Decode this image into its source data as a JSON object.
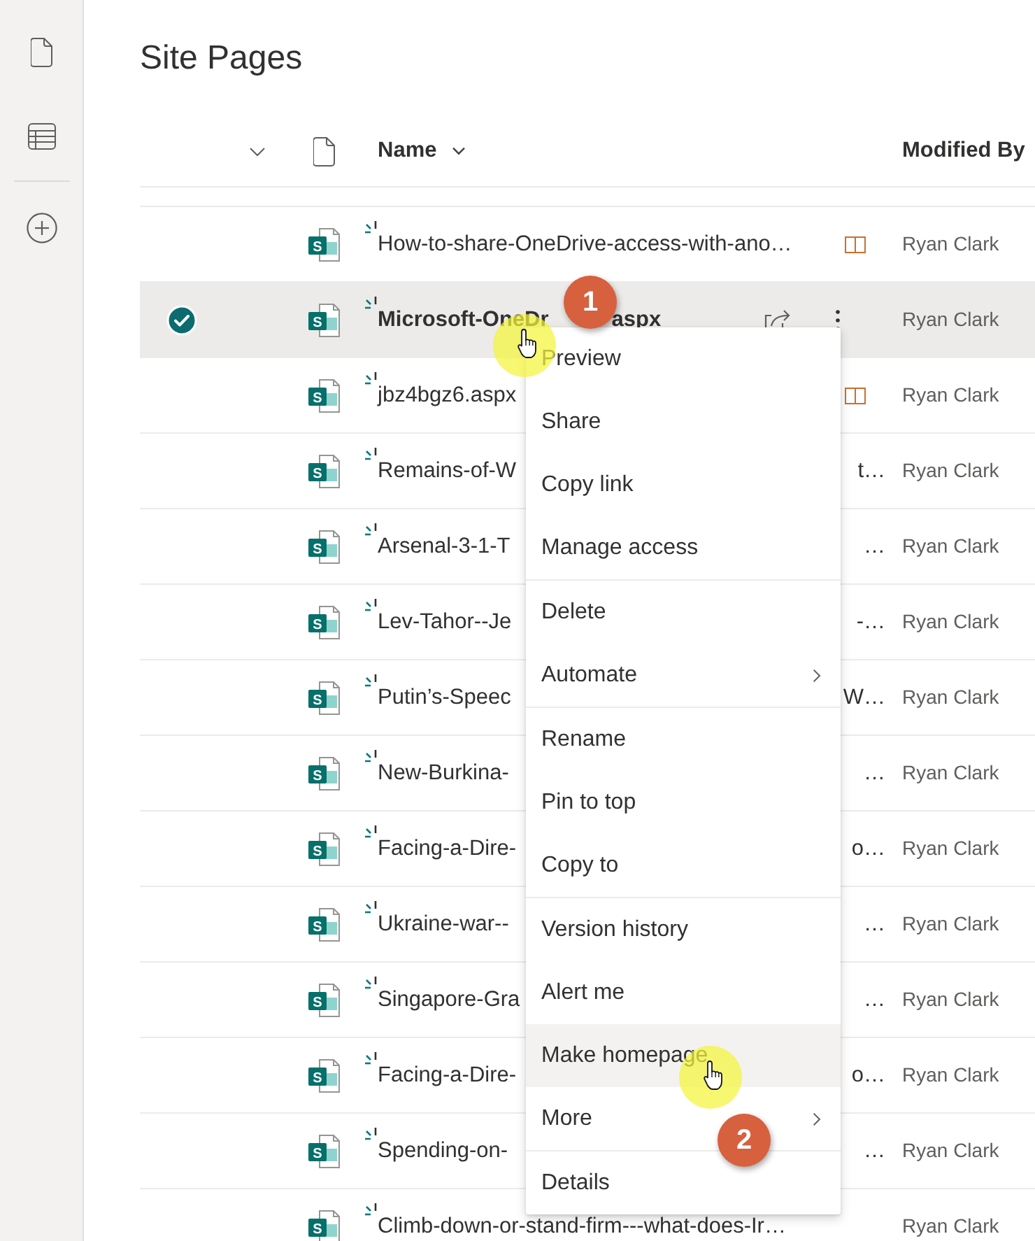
{
  "title": "Site Pages",
  "table": {
    "columns": [
      {
        "label": "Name",
        "dropdown": true
      },
      {
        "label": "Modified By"
      }
    ],
    "rows": [
      {
        "name": "How-to-share-OneDrive-access-with-ano…",
        "icon_letter": "S",
        "new": true,
        "status_icon": true,
        "selected": false,
        "modified_by": "Ryan Clark"
      },
      {
        "name": "Microsoft-OneDr",
        "name_after_badge": "aspx",
        "icon_letter": "S",
        "new": true,
        "status_icon": false,
        "selected": true,
        "modified_by": "Ryan Clark"
      },
      {
        "name": "jbz4bgz6.aspx",
        "icon_letter": "S",
        "new": true,
        "status_icon": true,
        "selected": false,
        "modified_by": "Ryan Clark"
      },
      {
        "name": "Remains-of-W",
        "name_end": "t…",
        "icon_letter": "S",
        "new": true,
        "status_icon": false,
        "selected": false,
        "modified_by": "Ryan Clark"
      },
      {
        "name": "Arsenal-3-1-T",
        "name_end": "…",
        "icon_letter": "S",
        "new": true,
        "status_icon": false,
        "selected": false,
        "modified_by": "Ryan Clark"
      },
      {
        "name": "Lev-Tahor--Je",
        "name_end": "-…",
        "icon_letter": "S",
        "new": true,
        "status_icon": false,
        "selected": false,
        "modified_by": "Ryan Clark"
      },
      {
        "name": "Putin’s-Speec",
        "name_end": "W…",
        "icon_letter": "S",
        "new": true,
        "status_icon": false,
        "selected": false,
        "modified_by": "Ryan Clark"
      },
      {
        "name": "New-Burkina-",
        "name_end": "…",
        "icon_letter": "S",
        "new": true,
        "status_icon": false,
        "selected": false,
        "modified_by": "Ryan Clark"
      },
      {
        "name": "Facing-a-Dire-",
        "name_end": "o…",
        "icon_letter": "S",
        "new": true,
        "status_icon": false,
        "selected": false,
        "modified_by": "Ryan Clark"
      },
      {
        "name": "Ukraine-war--",
        "name_end": "…",
        "icon_letter": "S",
        "new": true,
        "status_icon": false,
        "selected": false,
        "modified_by": "Ryan Clark"
      },
      {
        "name": "Singapore-Gra",
        "name_end": "…",
        "icon_letter": "S",
        "new": true,
        "status_icon": false,
        "selected": false,
        "modified_by": "Ryan Clark"
      },
      {
        "name": "Facing-a-Dire-",
        "name_end": "o…",
        "icon_letter": "S",
        "new": true,
        "status_icon": false,
        "selected": false,
        "modified_by": "Ryan Clark"
      },
      {
        "name": "Spending-on-",
        "name_end": "…",
        "icon_letter": "S",
        "new": true,
        "status_icon": false,
        "selected": false,
        "modified_by": "Ryan Clark"
      },
      {
        "name": "Climb-down-or-stand-firm---what-does-Ir…",
        "icon_letter": "S",
        "new": true,
        "status_icon": false,
        "selected": false,
        "modified_by": "Ryan Clark"
      }
    ]
  },
  "context_menu": {
    "groups": [
      {
        "items": [
          {
            "label": "Preview",
            "submenu": false,
            "selected": false
          },
          {
            "label": "Share",
            "submenu": false,
            "selected": false
          },
          {
            "label": "Copy link",
            "submenu": false,
            "selected": false
          },
          {
            "label": "Manage access",
            "submenu": false,
            "selected": false
          }
        ]
      },
      {
        "items": [
          {
            "label": "Delete",
            "submenu": false,
            "selected": false
          },
          {
            "label": "Automate",
            "submenu": true,
            "selected": false
          }
        ]
      },
      {
        "items": [
          {
            "label": "Rename",
            "submenu": false,
            "selected": false
          },
          {
            "label": "Pin to top",
            "submenu": false,
            "selected": false
          },
          {
            "label": "Copy to",
            "submenu": false,
            "selected": false
          }
        ]
      },
      {
        "items": [
          {
            "label": "Version history",
            "submenu": false,
            "selected": false
          },
          {
            "label": "Alert me",
            "submenu": false,
            "selected": false
          },
          {
            "label": "Make homepage",
            "submenu": false,
            "selected": true
          },
          {
            "label": "More",
            "submenu": true,
            "selected": false
          }
        ]
      },
      {
        "items": [
          {
            "label": "Details",
            "submenu": false,
            "selected": false
          }
        ]
      }
    ]
  },
  "annotations": [
    {
      "number": "1"
    },
    {
      "number": "2"
    }
  ]
}
